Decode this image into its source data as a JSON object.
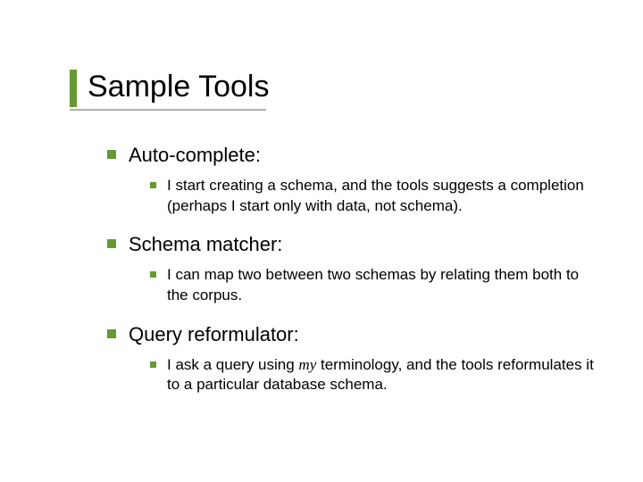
{
  "title": "Sample Tools",
  "items": [
    {
      "label": "Auto-complete:",
      "sub": "I start creating a schema, and the tools suggests a completion (perhaps I start only with data, not schema)."
    },
    {
      "label": "Schema matcher:",
      "sub": "I can map two between two schemas by relating them both to the corpus."
    },
    {
      "label": "Query reformulator:",
      "sub_pre": "I ask a query using ",
      "sub_em": "my",
      "sub_post": " terminology, and the tools reformulates it to a particular database schema."
    }
  ]
}
